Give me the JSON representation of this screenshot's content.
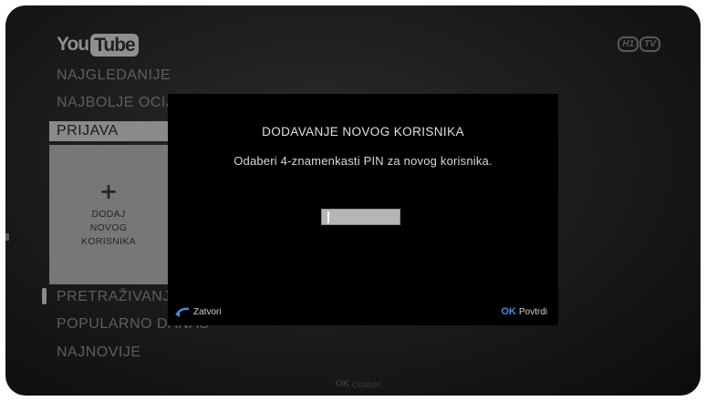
{
  "branding": {
    "youtube_you": "You",
    "youtube_tube": "Tube",
    "htv_left": "H1",
    "htv_right": "TV"
  },
  "menu": {
    "items": [
      "NAJGLEDANIJE",
      "NAJBOLJE OCIJEN",
      "PRIJAVA",
      "PRETRAŽIVANJE",
      "POPULARNO DANAS",
      "NAJNOVIJE"
    ],
    "add_user_tile": {
      "plus": "+",
      "line1": "DODAJ",
      "line2": "NOVOG",
      "line3": "KORISNIKA"
    }
  },
  "dialog": {
    "title": "DODAVANJE NOVOG KORISNIKA",
    "message": "Odaberi 4-znamenkasti PIN za novog korisnika.",
    "pin_value": "",
    "close_icon": "back-arrow-icon",
    "close_label": "Zatvori",
    "confirm_key": "OK",
    "confirm_label": "Povtrdi"
  },
  "footer": {
    "key": "OK",
    "label": "Odaberi"
  },
  "colors": {
    "accent_ok": "#3f8fd8",
    "selected_menu_bg": "#8a8a8a",
    "dialog_bg": "#000000"
  }
}
